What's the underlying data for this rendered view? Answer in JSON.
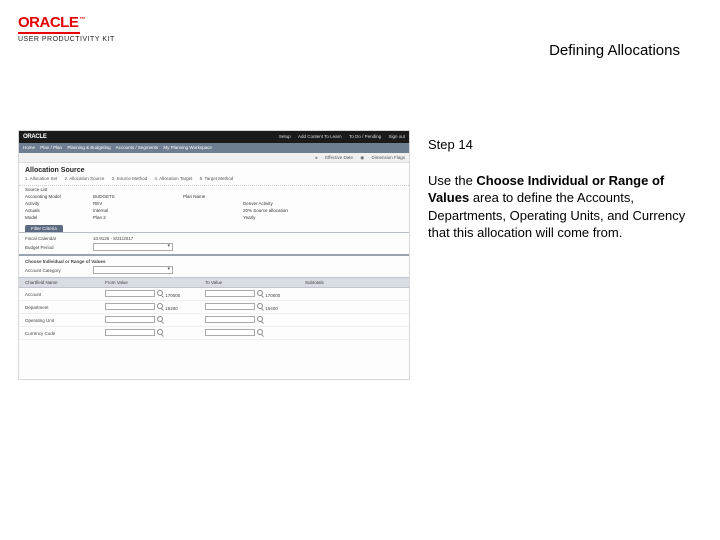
{
  "header": {
    "logo_text": "ORACLE",
    "logo_tm": "™",
    "upk": "USER PRODUCTIVITY KIT",
    "title": "Defining Allocations"
  },
  "instruction": {
    "step": "Step 14",
    "text_pre": "Use the ",
    "text_bold": "Choose Individual or Range of Values",
    "text_post": " area to define the Accounts, Departments, Operating Units, and Currency that this allocation will come from."
  },
  "screenshot": {
    "brand": "ORACLE",
    "top_menu": [
      "Setup",
      "Add Content To Learn",
      "To Do / Pending",
      "Sign out"
    ],
    "nav_left": [
      "Home",
      "Plan / Plan",
      "Planning & Budgeting",
      "Accounts / Segments",
      "My Planning Workspace"
    ],
    "subnav": [
      "Effective Date",
      "Dimension Flags"
    ],
    "section_title": "Allocation Source",
    "steps": [
      "1. Allocation Set",
      "2. Allocation Source",
      "3. Source Method",
      "4. Allocation Target",
      "5. Target Method"
    ],
    "fields": [
      {
        "lbl": "Source List",
        "val": "",
        "lbl2": "",
        "val2": ""
      },
      {
        "lbl": "Accounting Model",
        "val": "BUDGETS",
        "lbl2": "Plan Name",
        "val2": ""
      },
      {
        "lbl": "Activity",
        "val": "REV",
        "lbl2": "",
        "val2": "Denver Activity"
      },
      {
        "lbl": "Actuals",
        "val": "Internal",
        "lbl2": "",
        "val2": "20% Source allocation"
      },
      {
        "lbl": "Model",
        "val": "Plan 2",
        "lbl2": "",
        "val2": "Yearly"
      }
    ],
    "tab": "Filter Criteria",
    "rows": [
      {
        "label": "Fiscal Calendar",
        "value": "10.9125 - 8/31/2017"
      },
      {
        "label": "Budget Period",
        "value": ""
      }
    ],
    "panel2_title": "Choose Individual or Range of Values",
    "panel2_row": {
      "label": "Account Category",
      "dropdown": true
    },
    "grid_headers": [
      "Chartfield Name",
      "From Value",
      "To Value",
      "Subtotals"
    ],
    "grid_rows": [
      {
        "name": "Account",
        "from": "170000",
        "to": "170000"
      },
      {
        "name": "Department",
        "from": "15200",
        "to": "15400"
      },
      {
        "name": "Operating Unit",
        "from": "",
        "to": ""
      },
      {
        "name": "Currency Code",
        "from": "",
        "to": ""
      }
    ]
  }
}
